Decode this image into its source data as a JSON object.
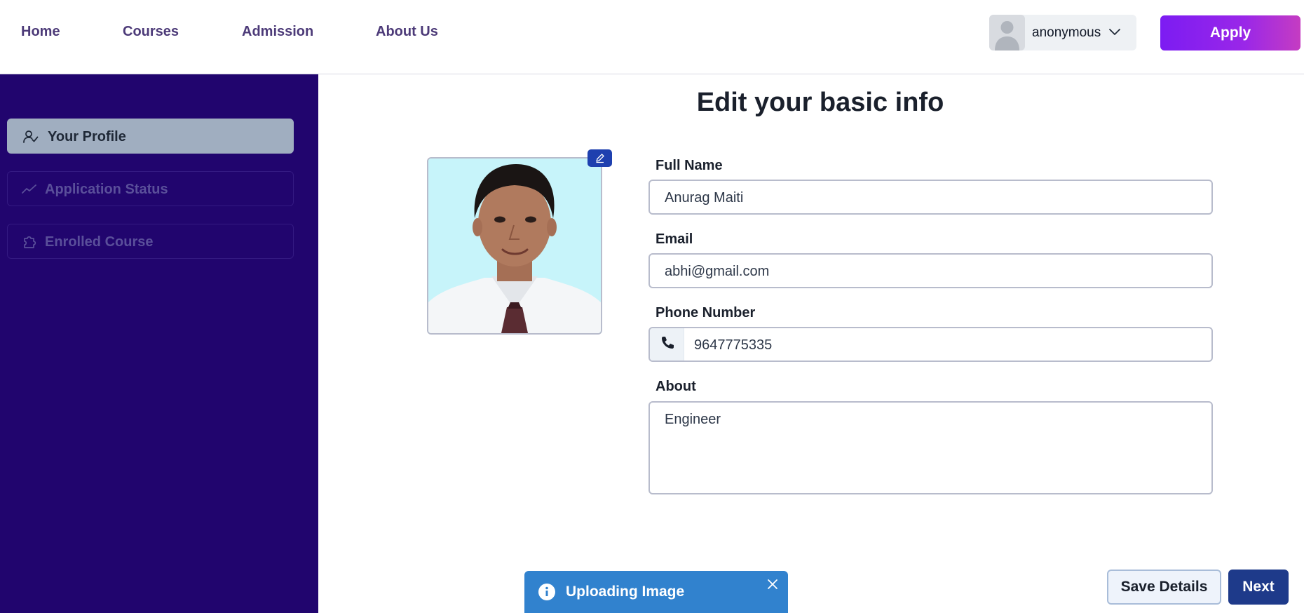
{
  "nav": {
    "links": [
      "Home",
      "Courses",
      "Admission",
      "About Us"
    ],
    "user_name": "anonymous",
    "apply_label": "Apply"
  },
  "sidebar": {
    "items": [
      {
        "label": "Your Profile",
        "icon": "user-check-icon",
        "active": true
      },
      {
        "label": "Application Status",
        "icon": "trending-line-icon",
        "active": false
      },
      {
        "label": "Enrolled Course",
        "icon": "puzzle-icon",
        "active": false
      }
    ]
  },
  "main": {
    "title": "Edit your basic info",
    "fields": {
      "full_name": {
        "label": "Full Name",
        "value": "Anurag Maiti"
      },
      "email": {
        "label": "Email",
        "value": "abhi@gmail.com"
      },
      "phone": {
        "label": "Phone Number",
        "value": "9647775335"
      },
      "about": {
        "label": "About",
        "value": "Engineer"
      }
    },
    "save_label": "Save Details",
    "next_label": "Next"
  },
  "toast": {
    "message": "Uploading Image"
  },
  "colors": {
    "sidebar_bg": "#21056e",
    "active_item_bg": "#a0aec0",
    "primary": "#1e3a8a",
    "toast_bg": "#3182ce",
    "apply_gradient_start": "#7c1cf2",
    "apply_gradient_end": "#c53cc2"
  }
}
